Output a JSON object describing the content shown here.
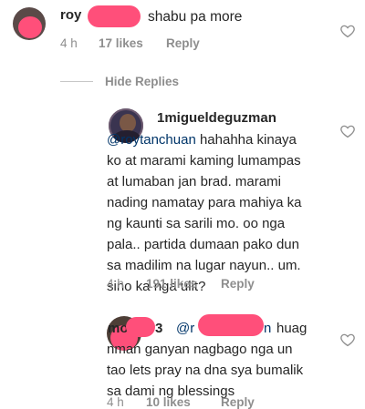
{
  "comment1": {
    "username": "roy",
    "text": "shabu pa more",
    "time": "4 h",
    "likes": "17 likes",
    "reply": "Reply"
  },
  "hide_replies": "Hide Replies",
  "reply1": {
    "username": "1migueldeguzman",
    "mention": "@roytanchuan",
    "lines": [
      "hahahha kinaya",
      "ko at marami kaming lumampas",
      "at lumaban  jan brad. marami",
      "nading namatay para mahiya ka",
      "ng kaunti sa sarili mo. oo nga",
      "pala.. partida dumaan pako dun",
      "sa madilim na lugar nayun.. um.",
      "sino ka nga ulit?"
    ],
    "time": "4 h",
    "likes": "191 likes",
    "reply": "Reply"
  },
  "reply2": {
    "username_start": "mo",
    "username_end": "3",
    "mention_start": "@r",
    "mention_end": "n",
    "first_text": "huag",
    "lines": [
      "nman ganyan nagbago nga un",
      "tao lets pray na dna sya bumalik",
      "sa dami ng blessings"
    ],
    "time": "4 h",
    "likes": "10 likes",
    "reply": "Reply"
  },
  "colors": {
    "text": "#262626",
    "meta": "#8e8e8e",
    "mention": "#003569",
    "redaction": "#ff4f7a"
  },
  "icons": [
    "heart-icon",
    "avatar"
  ]
}
